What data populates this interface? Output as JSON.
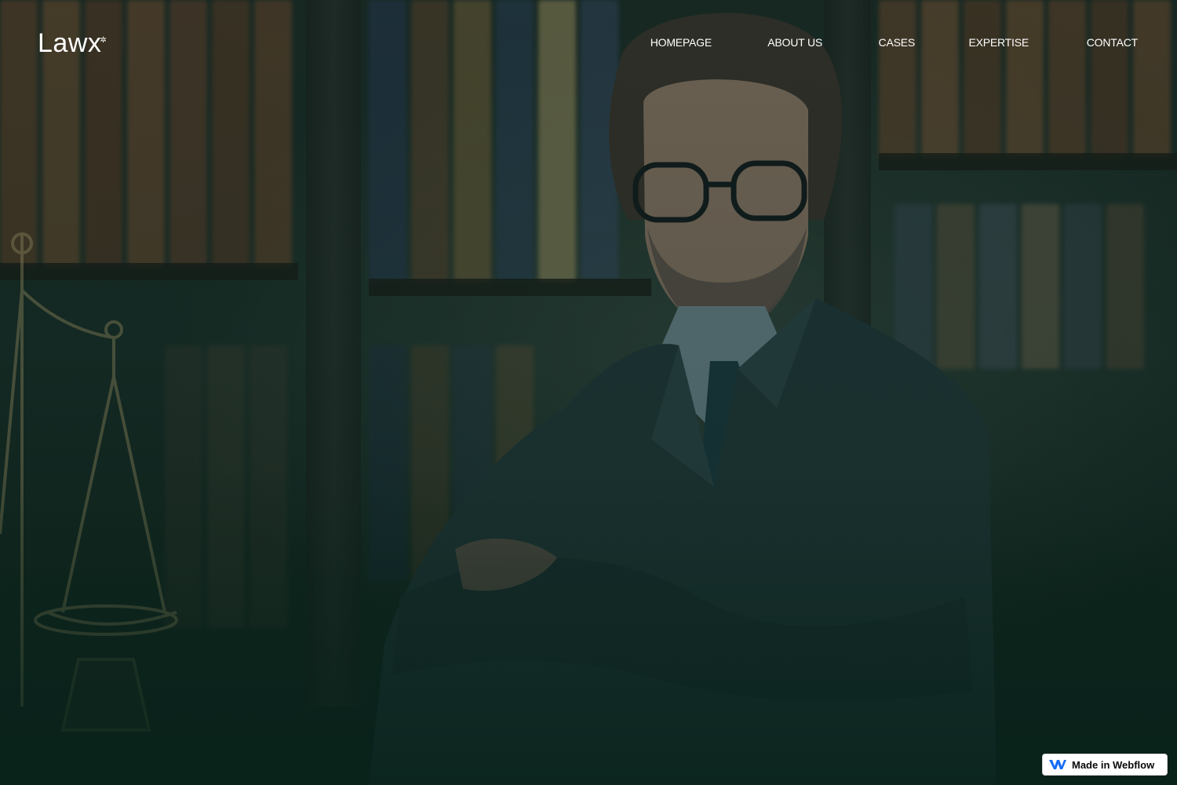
{
  "brand": {
    "logo_text": "Lawx",
    "logo_mark": "✲"
  },
  "nav": {
    "items": [
      {
        "label": "HOMEPAGE"
      },
      {
        "label": "ABOUT US"
      },
      {
        "label": "CASES"
      },
      {
        "label": "EXPERTISE"
      },
      {
        "label": "CONTACT"
      }
    ]
  },
  "hero": {
    "image_subject": "lawyer-portrait",
    "overlay_color": "#0f2a22"
  },
  "badge": {
    "label": "Made in Webflow",
    "icon": "webflow-logo-icon",
    "icon_color": "#146ef5"
  },
  "colors": {
    "nav_text": "#ffffff",
    "background": "#0f2a22"
  }
}
